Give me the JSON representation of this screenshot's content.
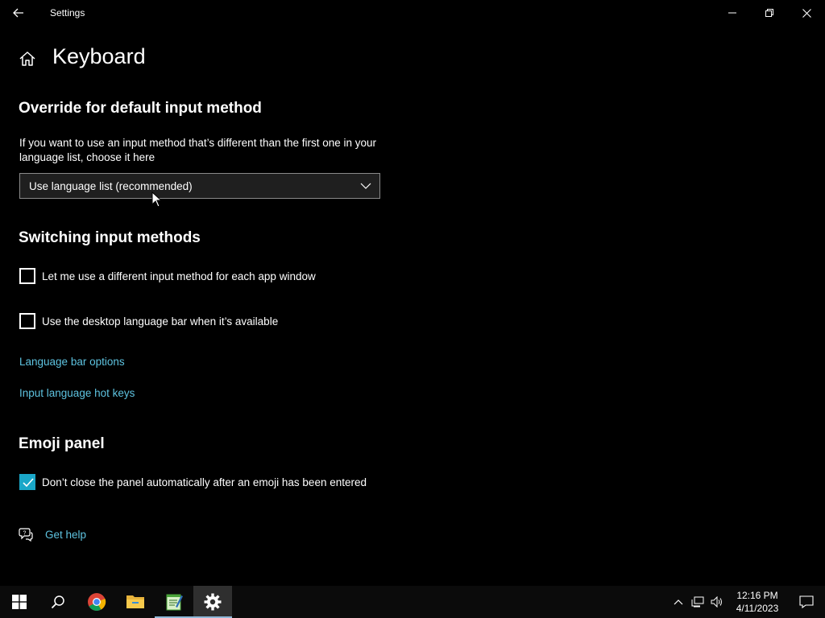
{
  "window": {
    "title": "Settings"
  },
  "page": {
    "title": "Keyboard"
  },
  "override_section": {
    "title": "Override for default input method",
    "description": "If you want to use an input method that’s different than the first one in your language list, choose it here",
    "dropdown_value": "Use language list (recommended)"
  },
  "switching_section": {
    "title": "Switching input methods",
    "options": [
      {
        "label": "Let me use a different input method for each app window",
        "checked": false
      },
      {
        "label": "Use the desktop language bar when it’s available",
        "checked": false
      }
    ],
    "links": [
      "Language bar options",
      "Input language hot keys"
    ]
  },
  "emoji_section": {
    "title": "Emoji panel",
    "option": {
      "label": "Don’t close the panel automatically after an emoji has been entered",
      "checked": true
    }
  },
  "help": {
    "label": "Get help"
  },
  "taskbar": {
    "apps": [
      "start-icon",
      "search-icon",
      "chrome-icon",
      "file-explorer-icon",
      "notepad-icon",
      "settings-icon"
    ],
    "active_app": "settings-icon",
    "clock_time": "12:16 PM",
    "clock_date": "4/11/2023"
  },
  "colors": {
    "accent": "#1aa7c8",
    "link": "#5ec3e0",
    "background": "#000000"
  }
}
